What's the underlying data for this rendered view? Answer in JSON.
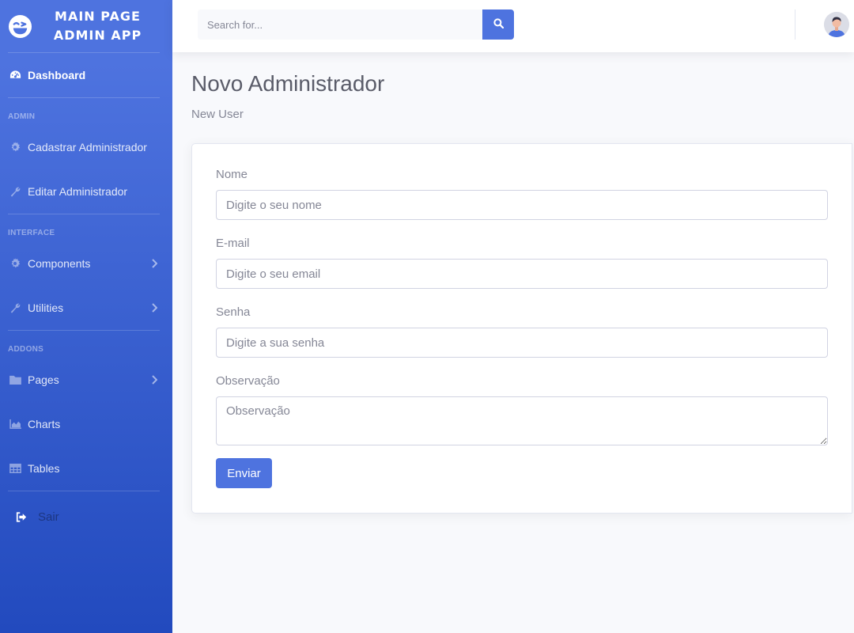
{
  "brand": {
    "line1": "MAIN PAGE",
    "line2": "ADMIN APP"
  },
  "sidebar": {
    "dashboard": "Dashboard",
    "sections": [
      {
        "heading": "ADMIN",
        "items": [
          {
            "label": "Cadastrar Administrador",
            "icon": "gear-icon"
          },
          {
            "label": "Editar Administrador",
            "icon": "wrench-icon"
          }
        ]
      },
      {
        "heading": "INTERFACE",
        "items": [
          {
            "label": "Components",
            "icon": "gear-icon",
            "chevron": true
          },
          {
            "label": "Utilities",
            "icon": "wrench-icon",
            "chevron": true
          }
        ]
      },
      {
        "heading": "ADDONS",
        "items": [
          {
            "label": "Pages",
            "icon": "folder-icon",
            "chevron": true
          },
          {
            "label": "Charts",
            "icon": "area-chart-icon"
          },
          {
            "label": "Tables",
            "icon": "table-icon"
          }
        ]
      }
    ],
    "logout": "Sair"
  },
  "topbar": {
    "search_placeholder": "Search for..."
  },
  "page": {
    "title": "Novo Administrador",
    "subtitle": "New User"
  },
  "form": {
    "name_label": "Nome",
    "name_placeholder": "Digite o seu nome",
    "email_label": "E-mail",
    "email_placeholder": "Digite o seu email",
    "password_label": "Senha",
    "password_placeholder": "Digite a sua senha",
    "notes_label": "Observação",
    "notes_placeholder": "Observação",
    "submit": "Enviar"
  },
  "colors": {
    "primary": "#4e73df",
    "primary_dark": "#224abe",
    "background": "#f8f9fc"
  }
}
